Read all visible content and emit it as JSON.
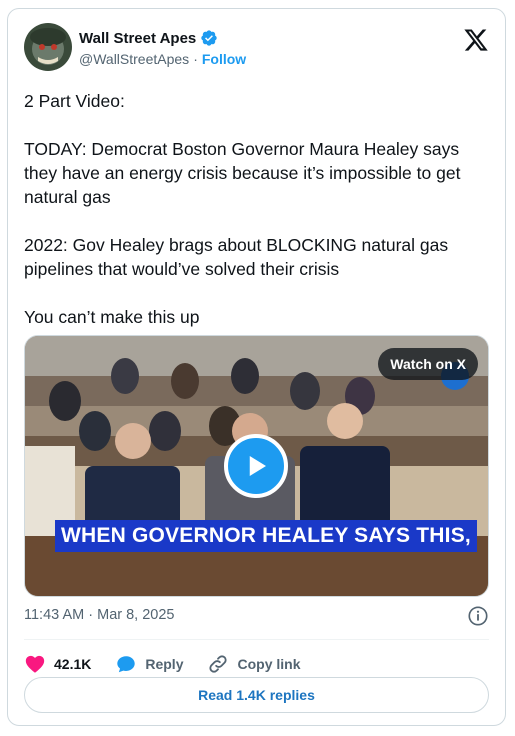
{
  "author": {
    "name": "Wall Street Apes",
    "handle": "@WallStreetApes",
    "separator": "·",
    "follow_label": "Follow"
  },
  "tweet": {
    "paragraphs": [
      "2 Part Video:",
      "TODAY: Democrat Boston Governor Maura Healey says they have an energy crisis because  it’s impossible to get natural gas",
      "2022: Gov Healey brags about BLOCKING natural gas pipelines that would’ve solved their crisis",
      "You can’t make this up"
    ]
  },
  "media": {
    "watch_label": "Watch on X",
    "caption": "WHEN GOVERNOR HEALEY SAYS THIS,"
  },
  "meta": {
    "time": "11:43 AM",
    "date": "Mar 8, 2025",
    "separator": "·"
  },
  "actions": {
    "likes": "42.1K",
    "reply_label": "Reply",
    "copy_label": "Copy link"
  },
  "replies_label": "Read 1.4K replies",
  "colors": {
    "accent": "#1d9bf0",
    "like": "#f91880",
    "caption_bg": "#1a39c8"
  }
}
